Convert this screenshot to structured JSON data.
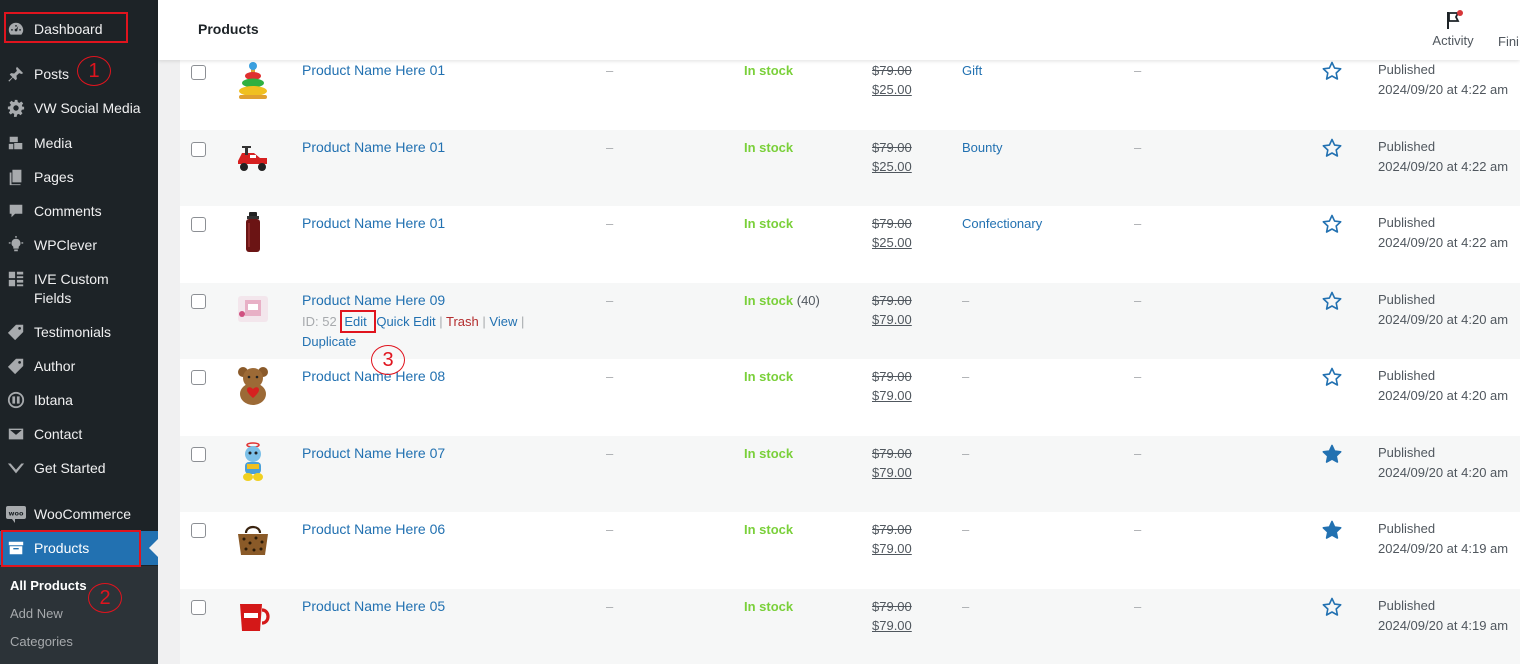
{
  "sidebar": {
    "items": [
      {
        "label": "Dashboard",
        "icon": "dashboard-icon"
      },
      {
        "label": "Posts",
        "icon": "pin-icon"
      },
      {
        "label": "VW Social Media",
        "icon": "gear-icon"
      },
      {
        "label": "Media",
        "icon": "media-icon"
      },
      {
        "label": "Pages",
        "icon": "pages-icon"
      },
      {
        "label": "Comments",
        "icon": "comment-icon"
      },
      {
        "label": "WPClever",
        "icon": "bulb-icon"
      },
      {
        "label": "IVE Custom Fields",
        "icon": "grid-icon"
      },
      {
        "label": "Testimonials",
        "icon": "tag-icon"
      },
      {
        "label": "Author",
        "icon": "tag-icon"
      },
      {
        "label": "Ibtana",
        "icon": "ibtana-icon"
      },
      {
        "label": "Contact",
        "icon": "mail-icon"
      },
      {
        "label": "Get Started",
        "icon": "chevron-down-icon"
      },
      {
        "label": "WooCommerce",
        "icon": "woo-icon"
      },
      {
        "label": "Products",
        "icon": "archive-icon"
      }
    ],
    "submenu": [
      "All Products",
      "Add New",
      "Categories"
    ]
  },
  "header": {
    "title": "Products",
    "activity_label": "Activity",
    "finish_label": "Fini"
  },
  "rows": [
    {
      "name": "Product Name Here 01",
      "sku": "–",
      "stock": "In stock",
      "stock_count": "",
      "price_old": "$79.00",
      "price_new": "$25.00",
      "category": "Gift",
      "tags": "–",
      "featured": false,
      "status": "Published",
      "date": "2024/09/20 at 4:22 am"
    },
    {
      "name": "Product Name Here 01",
      "sku": "–",
      "stock": "In stock",
      "stock_count": "",
      "price_old": "$79.00",
      "price_new": "$25.00",
      "category": "Bounty",
      "tags": "–",
      "featured": false,
      "status": "Published",
      "date": "2024/09/20 at 4:22 am"
    },
    {
      "name": "Product Name Here 01",
      "sku": "–",
      "stock": "In stock",
      "stock_count": "",
      "price_old": "$79.00",
      "price_new": "$25.00",
      "category": "Confectionary",
      "tags": "–",
      "featured": false,
      "status": "Published",
      "date": "2024/09/20 at 4:22 am"
    },
    {
      "name": "Product Name Here 09",
      "sku": "–",
      "stock": "In stock",
      "stock_count": "(40)",
      "price_old": "$79.00",
      "price_new": "$79.00",
      "category": "–",
      "tags": "–",
      "featured": false,
      "status": "Published",
      "date": "2024/09/20 at 4:20 am"
    },
    {
      "name": "Product Name Here 08",
      "sku": "–",
      "stock": "In stock",
      "stock_count": "",
      "price_old": "$79.00",
      "price_new": "$79.00",
      "category": "–",
      "tags": "–",
      "featured": false,
      "status": "Published",
      "date": "2024/09/20 at 4:20 am"
    },
    {
      "name": "Product Name Here 07",
      "sku": "–",
      "stock": "In stock",
      "stock_count": "",
      "price_old": "$79.00",
      "price_new": "$79.00",
      "category": "–",
      "tags": "–",
      "featured": true,
      "status": "Published",
      "date": "2024/09/20 at 4:20 am"
    },
    {
      "name": "Product Name Here 06",
      "sku": "–",
      "stock": "In stock",
      "stock_count": "",
      "price_old": "$79.00",
      "price_new": "$79.00",
      "category": "–",
      "tags": "–",
      "featured": true,
      "status": "Published",
      "date": "2024/09/20 at 4:19 am"
    },
    {
      "name": "Product Name Here 05",
      "sku": "–",
      "stock": "In stock",
      "stock_count": "",
      "price_old": "$79.00",
      "price_new": "$79.00",
      "category": "–",
      "tags": "–",
      "featured": false,
      "status": "Published",
      "date": "2024/09/20 at 4:19 am"
    }
  ],
  "row_actions": {
    "id_label": "ID: 52",
    "edit": "Edit",
    "quick_edit": "Quick Edit",
    "trash": "Trash",
    "view": "View",
    "duplicate": "Duplicate",
    "separator": "|"
  },
  "annotations": [
    "1",
    "2",
    "3"
  ],
  "colors": {
    "sidebar_bg": "#1d2327",
    "accent": "#2271b1",
    "in_stock": "#7ad03a",
    "annotation": "#e0141e",
    "trash": "#b32d2e"
  }
}
